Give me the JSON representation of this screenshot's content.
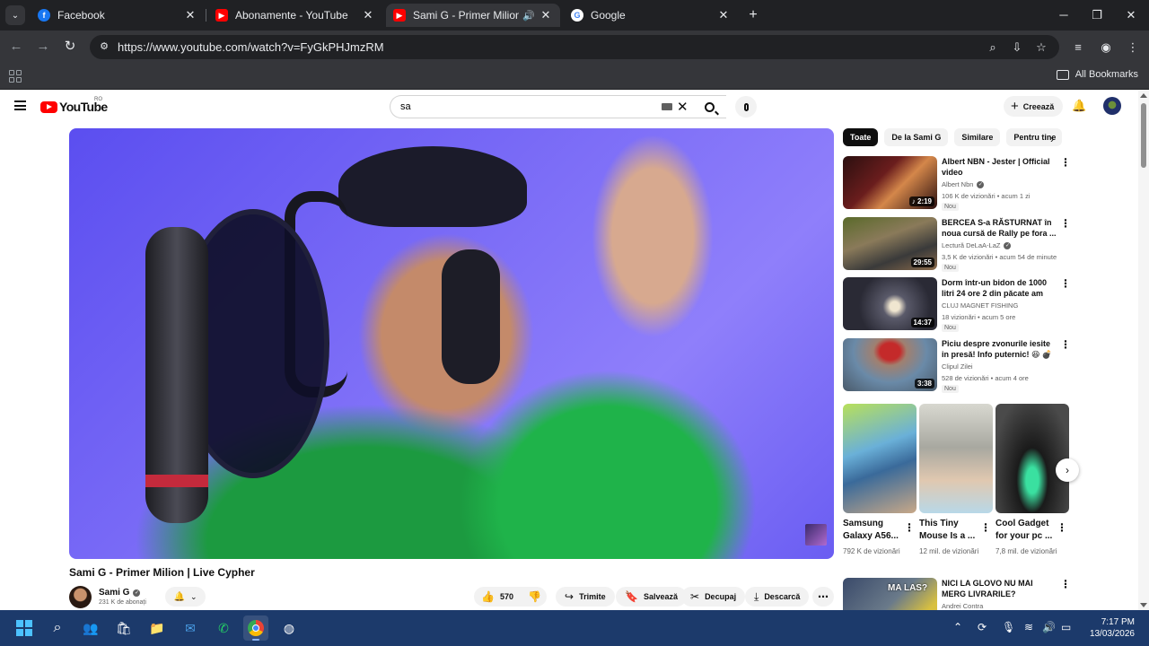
{
  "browser": {
    "tabs": [
      {
        "title": "Facebook",
        "favicon": "facebook-icon",
        "color": "#1877f2"
      },
      {
        "title": "Abonamente - YouTube",
        "favicon": "youtube-icon",
        "color": "#ff0000"
      },
      {
        "title": "Sami G - Primer Milion | Live Cypher",
        "favicon": "youtube-icon",
        "color": "#ff0000",
        "active": true,
        "audio": true
      },
      {
        "title": "Google",
        "favicon": "google-icon",
        "color": "#4285f4"
      }
    ],
    "url": "https://www.youtube.com/watch?v=FyGkPHJmzRM",
    "all_bookmarks": "All Bookmarks"
  },
  "youtube": {
    "logo_text": "YouTube",
    "country_code": "RO",
    "search_value": "sa",
    "create_label": "Creează",
    "video": {
      "title": "Sami G - Primer Milion | Live Cypher",
      "channel": "Sami G",
      "subscribers": "231 K de abonați",
      "likes": "570",
      "share": "Trimite",
      "save": "Salvează",
      "clip": "Decupaj",
      "download": "Descarcă"
    },
    "chips": [
      "Toate",
      "De la Sami G",
      "Similare",
      "Pentru tine"
    ],
    "recommendations": [
      {
        "title": "Albert NBN - Jester | Official video",
        "channel": "Albert Nbn",
        "verified": true,
        "meta": "106 K de vizionări • acum 1 zi",
        "badge": "Nou",
        "duration": "♪ 2:19"
      },
      {
        "title": "BERCEA S-a RĂSTURNAT în noua cursă de Rally pe fora ...",
        "channel": "Lectură DeLaA-LaZ",
        "verified": true,
        "meta": "3,5 K de vizionări • acum 54 de minute",
        "badge": "Nou",
        "duration": "29:55"
      },
      {
        "title": "Dorm într-un bidon de 1000 litri 24 ore 2 din păcate am ieșit la ...",
        "channel": "CLUJ MAGNET FISHING",
        "verified": false,
        "meta": "18 vizionări • acum 5 ore",
        "badge": "Nou",
        "duration": "14:37"
      },
      {
        "title": "Piciu despre zvonurile iesite in presă! Info puternic! 😆 💣 🗼",
        "channel": "Clipul Zilei",
        "verified": false,
        "meta": "528 de vizionări • acum 4 ore",
        "badge": "Nou",
        "duration": "3:38"
      }
    ],
    "shorts": [
      {
        "title": "Samsung Galaxy A56...",
        "meta": "792 K de vizionări"
      },
      {
        "title": "This Tiny Mouse Is a ...",
        "meta": "12 mil. de vizionări"
      },
      {
        "title": "Cool Gadget for your pc ...",
        "meta": "7,8 mil. de vizionări"
      }
    ],
    "next_rec": {
      "title": "NICI LA GLOVO NU MAI MERG LIVRARILE?",
      "channel": "Andrei Contra",
      "thumb_text": "MA LAS?"
    }
  },
  "taskbar": {
    "time": "7:17 PM",
    "date": "13/03/2026"
  },
  "colors": {
    "youtube_red": "#ff0000",
    "chrome_dark": "#202124",
    "chrome_toolbar": "#35363a",
    "taskbar": "#1c3a6b"
  }
}
